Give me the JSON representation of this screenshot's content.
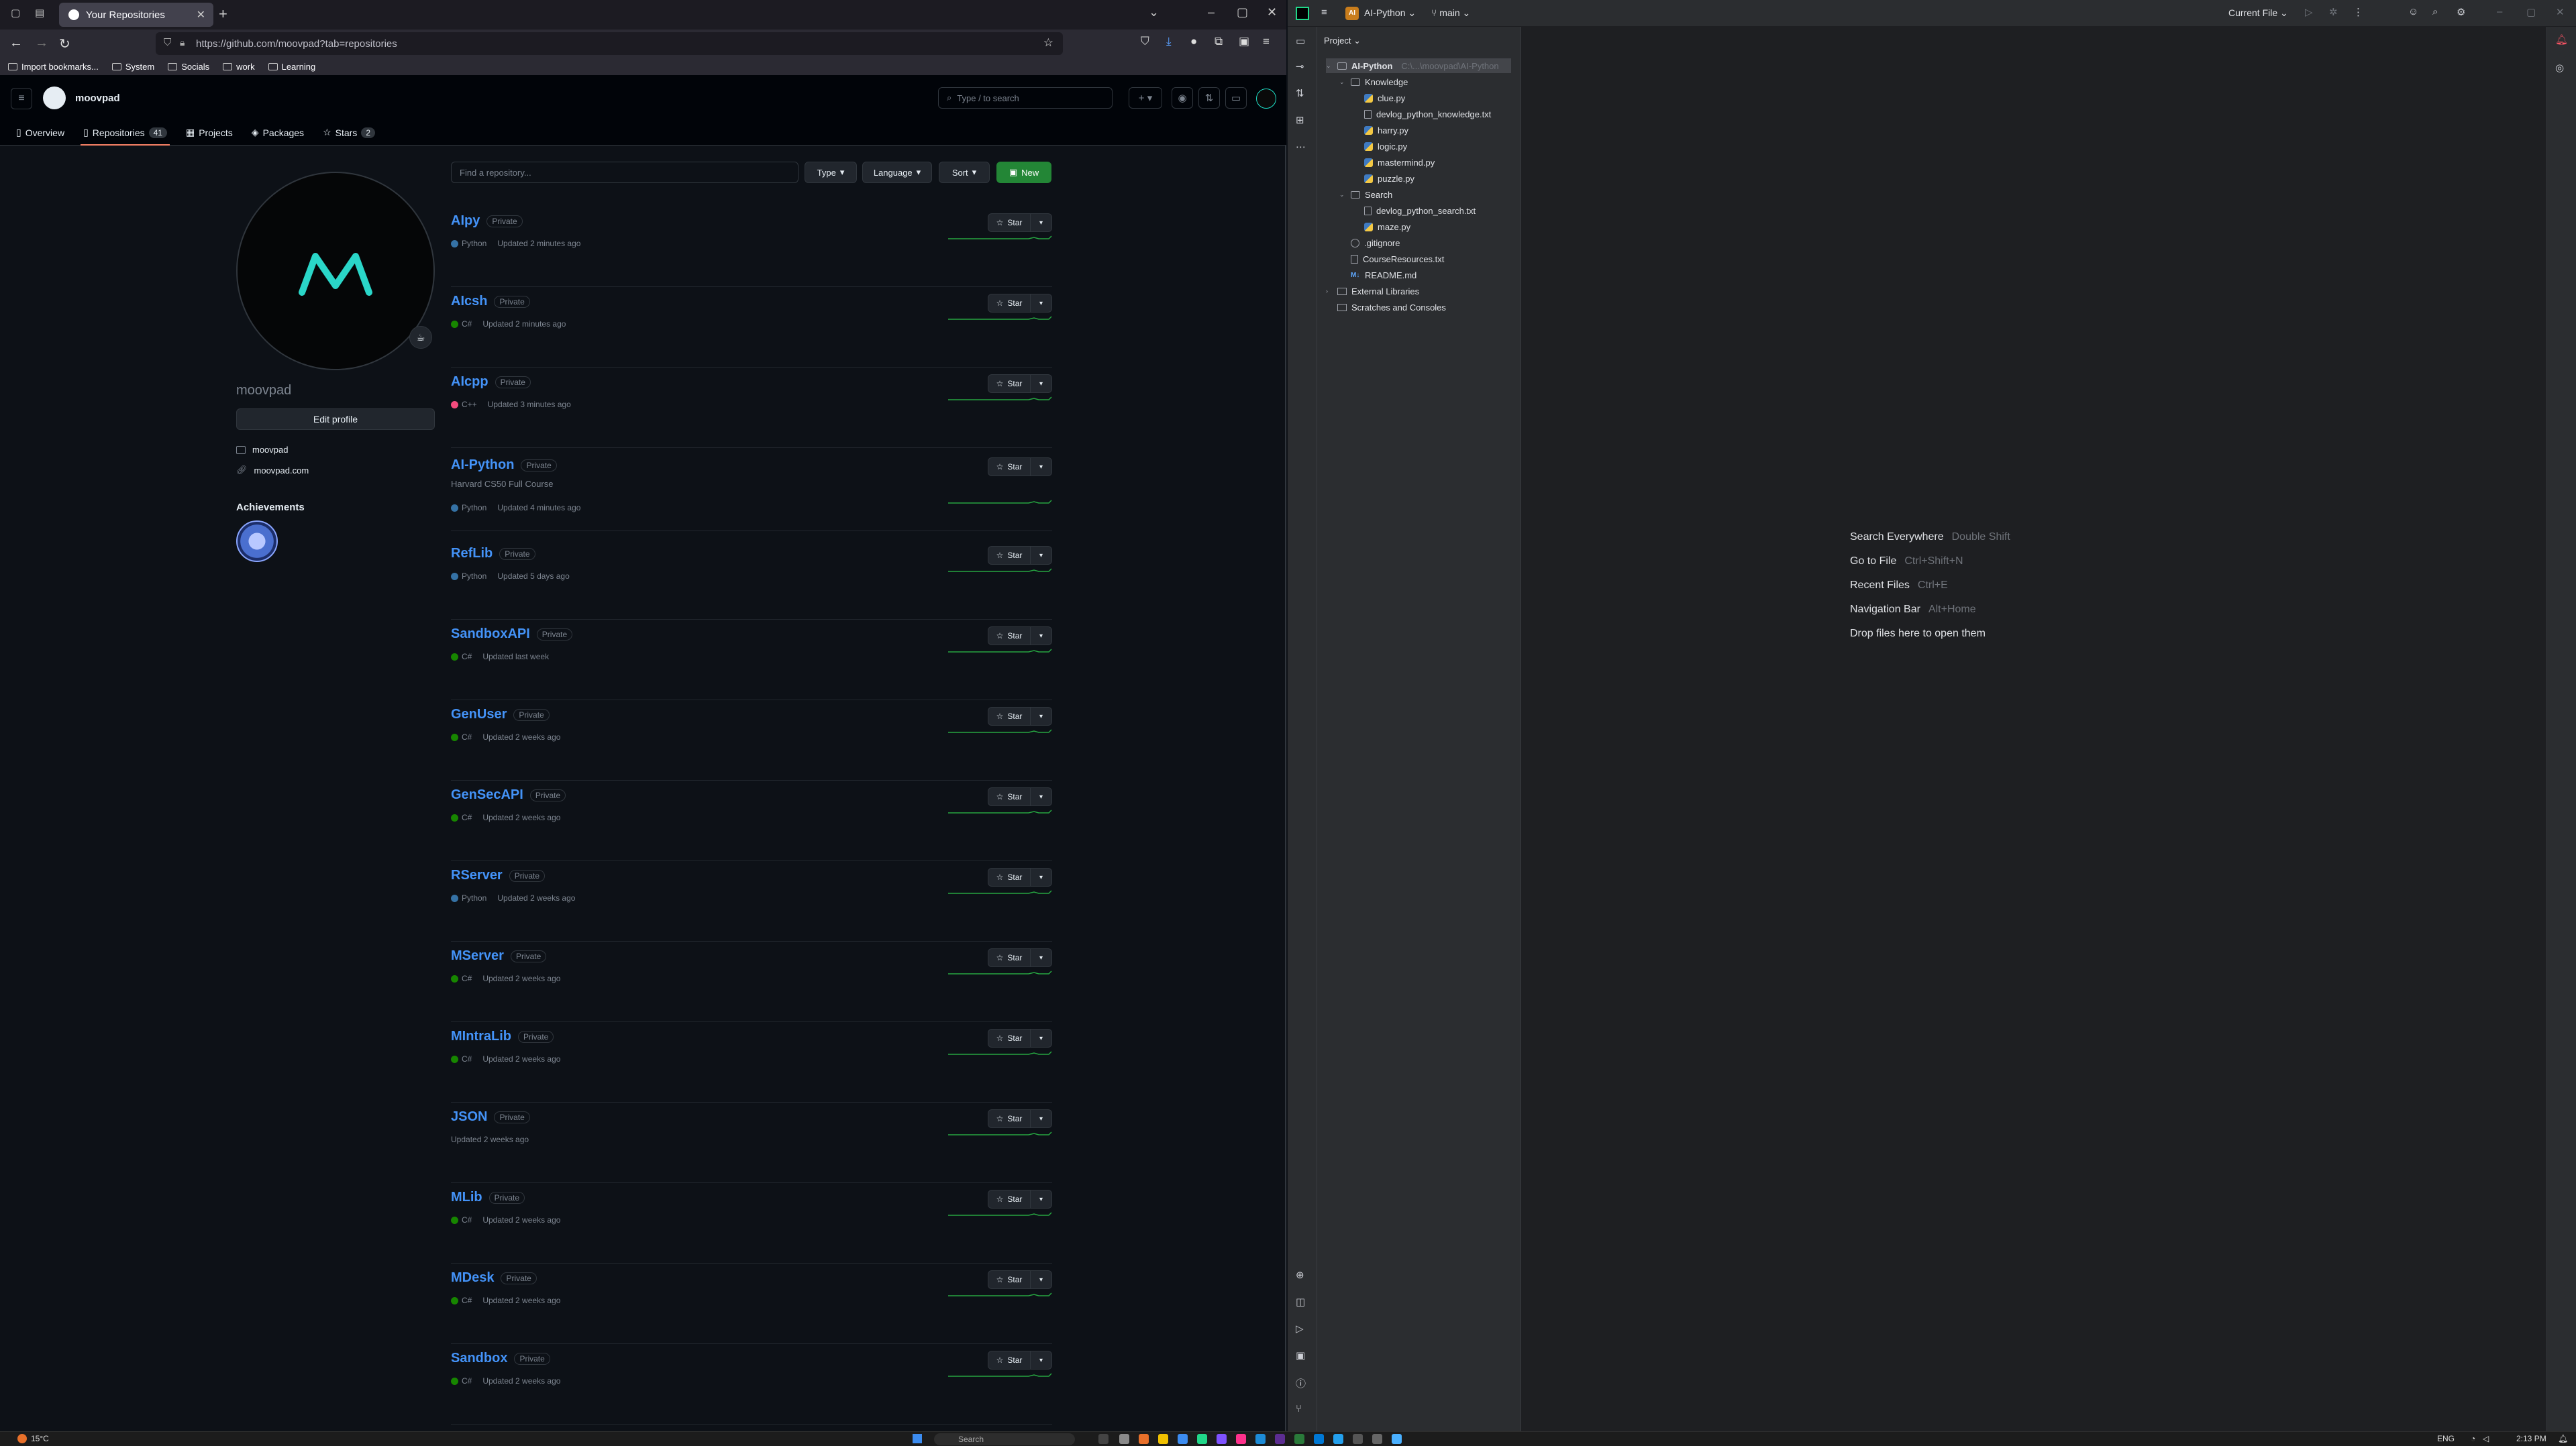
{
  "browser": {
    "tab_title": "Your Repositories",
    "url": "https://github.com/moovpad?tab=repositories",
    "bookmarks": [
      "Import bookmarks...",
      "System",
      "Socials",
      "work",
      "Learning"
    ]
  },
  "github": {
    "username": "moovpad",
    "search_placeholder": "Type / to search",
    "tabs": [
      {
        "label": "Overview",
        "icon": "book-icon"
      },
      {
        "label": "Repositories",
        "count": "41",
        "icon": "repo-icon"
      },
      {
        "label": "Projects",
        "icon": "table-icon"
      },
      {
        "label": "Packages",
        "icon": "package-icon"
      },
      {
        "label": "Stars",
        "count": "2",
        "icon": "star-icon"
      }
    ],
    "profile": {
      "name": "moovpad",
      "edit_label": "Edit profile",
      "org": "moovpad",
      "website": "moovpad.com",
      "achievements_title": "Achievements"
    },
    "filters": {
      "find_placeholder": "Find a repository...",
      "type_label": "Type",
      "language_label": "Language",
      "sort_label": "Sort",
      "new_label": "New"
    },
    "star_label": "Star",
    "private_label": "Private",
    "repos": [
      {
        "name": "AIpy",
        "description": "",
        "language": "Python",
        "lang_color": "#3572A5",
        "updated": "Updated 2 minutes ago"
      },
      {
        "name": "AIcsh",
        "description": "",
        "language": "C#",
        "lang_color": "#178600",
        "updated": "Updated 2 minutes ago"
      },
      {
        "name": "AIcpp",
        "description": "",
        "language": "C++",
        "lang_color": "#f34b7d",
        "updated": "Updated 3 minutes ago"
      },
      {
        "name": "AI-Python",
        "description": "Harvard CS50 Full Course",
        "language": "Python",
        "lang_color": "#3572A5",
        "updated": "Updated 4 minutes ago"
      },
      {
        "name": "RefLib",
        "description": "",
        "language": "Python",
        "lang_color": "#3572A5",
        "updated": "Updated 5 days ago"
      },
      {
        "name": "SandboxAPI",
        "description": "",
        "language": "C#",
        "lang_color": "#178600",
        "updated": "Updated last week"
      },
      {
        "name": "GenUser",
        "description": "",
        "language": "C#",
        "lang_color": "#178600",
        "updated": "Updated 2 weeks ago"
      },
      {
        "name": "GenSecAPI",
        "description": "",
        "language": "C#",
        "lang_color": "#178600",
        "updated": "Updated 2 weeks ago"
      },
      {
        "name": "RServer",
        "description": "",
        "language": "Python",
        "lang_color": "#3572A5",
        "updated": "Updated 2 weeks ago"
      },
      {
        "name": "MServer",
        "description": "",
        "language": "C#",
        "lang_color": "#178600",
        "updated": "Updated 2 weeks ago"
      },
      {
        "name": "MIntraLib",
        "description": "",
        "language": "C#",
        "lang_color": "#178600",
        "updated": "Updated 2 weeks ago"
      },
      {
        "name": "JSON",
        "description": "",
        "language": "",
        "lang_color": "",
        "updated": "Updated 2 weeks ago"
      },
      {
        "name": "MLib",
        "description": "",
        "language": "C#",
        "lang_color": "#178600",
        "updated": "Updated 2 weeks ago"
      },
      {
        "name": "MDesk",
        "description": "",
        "language": "C#",
        "lang_color": "#178600",
        "updated": "Updated 2 weeks ago"
      },
      {
        "name": "Sandbox",
        "description": "",
        "language": "C#",
        "lang_color": "#178600",
        "updated": "Updated 2 weeks ago"
      }
    ]
  },
  "ide": {
    "project_badge": "AI",
    "project_name": "AI-Python",
    "branch": "main",
    "run_config": "Current File",
    "panel_title": "Project",
    "tree": [
      {
        "label": "AI-Python",
        "suffix": "C:\\...\\moovpad\\AI-Python",
        "kind": "folder",
        "level": 0,
        "expanded": true
      },
      {
        "label": "Knowledge",
        "kind": "folder",
        "level": 1,
        "expanded": true
      },
      {
        "label": "clue.py",
        "kind": "py",
        "level": 2
      },
      {
        "label": "devlog_python_knowledge.txt",
        "kind": "txt",
        "level": 2
      },
      {
        "label": "harry.py",
        "kind": "py",
        "level": 2
      },
      {
        "label": "logic.py",
        "kind": "py",
        "level": 2
      },
      {
        "label": "mastermind.py",
        "kind": "py",
        "level": 2
      },
      {
        "label": "puzzle.py",
        "kind": "py",
        "level": 2
      },
      {
        "label": "Search",
        "kind": "folder",
        "level": 1,
        "expanded": true
      },
      {
        "label": "devlog_python_search.txt",
        "kind": "txt",
        "level": 2
      },
      {
        "label": "maze.py",
        "kind": "py",
        "level": 2
      },
      {
        "label": ".gitignore",
        "kind": "ignore",
        "level": 1
      },
      {
        "label": "CourseResources.txt",
        "kind": "txt",
        "level": 1
      },
      {
        "label": "README.md",
        "kind": "md",
        "level": 1
      },
      {
        "label": "External Libraries",
        "kind": "lib",
        "level": 0,
        "expanded": false
      },
      {
        "label": "Scratches and Consoles",
        "kind": "scratch",
        "level": 0
      }
    ],
    "hints": [
      {
        "label": "Search Everywhere",
        "shortcut": "Double Shift"
      },
      {
        "label": "Go to File",
        "shortcut": "Ctrl+Shift+N"
      },
      {
        "label": "Recent Files",
        "shortcut": "Ctrl+E"
      },
      {
        "label": "Navigation Bar",
        "shortcut": "Alt+Home"
      },
      {
        "label": "Drop files here to open them",
        "shortcut": ""
      }
    ]
  },
  "taskbar": {
    "weather": "15°C",
    "search_placeholder": "Search",
    "lang": "ENG",
    "time": "2:13 PM"
  }
}
